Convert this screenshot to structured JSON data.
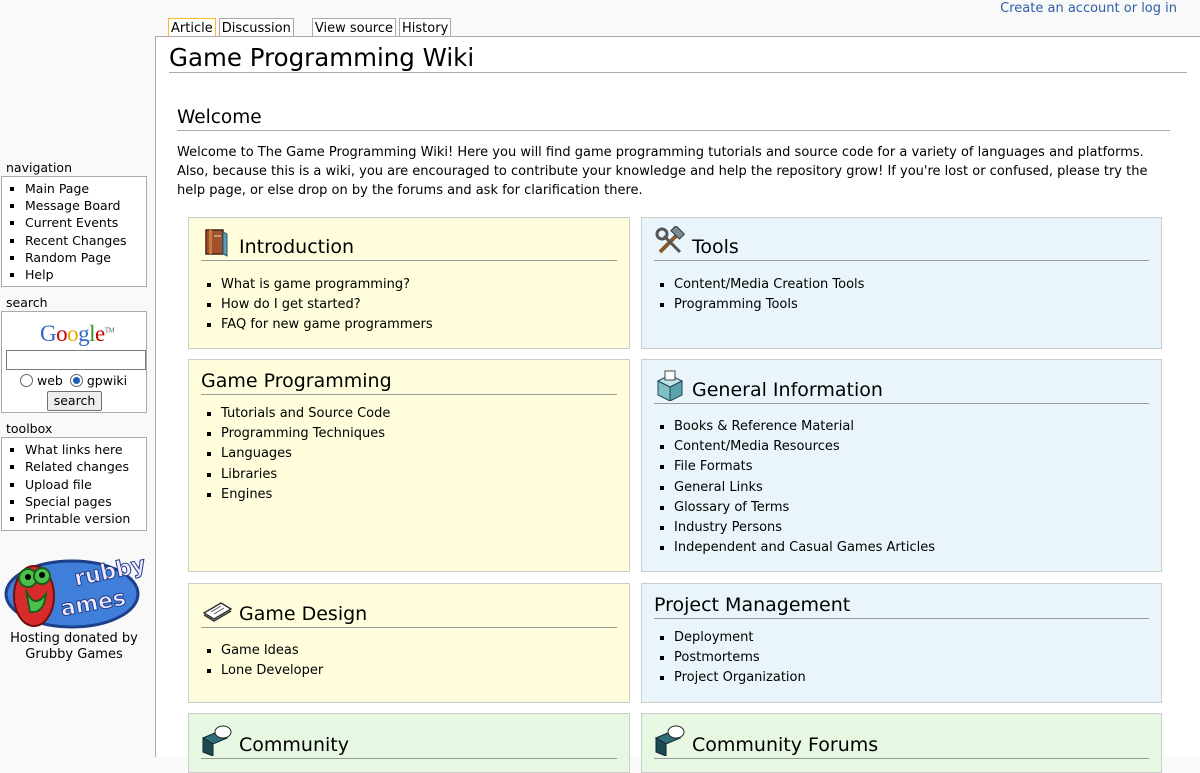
{
  "user_link": "Create an account or log in",
  "tabs": [
    "Article",
    "Discussion",
    "View source",
    "History"
  ],
  "sidebar": {
    "navigation": {
      "heading": "navigation",
      "items": [
        "Main Page",
        "Message Board",
        "Current Events",
        "Recent Changes",
        "Random Page",
        "Help"
      ]
    },
    "search": {
      "heading": "search",
      "logo_text": "Google",
      "logo_tm": "TM",
      "radio_web": "web",
      "radio_gpwiki": "gpwiki",
      "button": "search",
      "selected": "gpwiki"
    },
    "toolbox": {
      "heading": "toolbox",
      "items": [
        "What links here",
        "Related changes",
        "Upload file",
        "Special pages",
        "Printable version"
      ]
    },
    "sponsor": {
      "logo_text": "Grubby Games",
      "line1": "Hosting donated by",
      "line2": "Grubby Games"
    }
  },
  "page": {
    "title": "Game Programming Wiki",
    "welcome_heading": "Welcome",
    "intro_text": "Welcome to The Game Programming Wiki! Here you will find game programming tutorials and source code for a variety of languages and platforms. Also, because this is a wiki, you are encouraged to contribute your knowledge and help the repository grow! If you're lost or confused, please try the help page, or else drop on by the forums and ask for clarification there."
  },
  "boxes": {
    "introduction": {
      "title": "Introduction",
      "icon": "book-icon",
      "items": [
        "What is game programming?",
        "How do I get started?",
        "FAQ for new game programmers"
      ]
    },
    "tools": {
      "title": "Tools",
      "icon": "tools-icon",
      "items": [
        "Content/Media Creation Tools",
        "Programming Tools"
      ]
    },
    "game_programming": {
      "title": "Game Programming",
      "items": [
        "Tutorials and Source Code",
        "Programming Techniques",
        "Languages",
        "Libraries",
        "Engines"
      ]
    },
    "general_info": {
      "title": "General Information",
      "icon": "box-icon",
      "items": [
        "Books & Reference Material",
        "Content/Media Resources",
        "File Formats",
        "General Links",
        "Glossary of Terms",
        "Industry Persons",
        "Independent and Casual Games Articles"
      ]
    },
    "game_design": {
      "title": "Game Design",
      "icon": "paper-icon",
      "items": [
        "Game Ideas",
        "Lone Developer"
      ]
    },
    "project_management": {
      "title": "Project Management",
      "items": [
        "Deployment",
        "Postmortems",
        "Project Organization"
      ]
    },
    "community": {
      "title": "Community",
      "icon": "chat-icon"
    },
    "community_forums": {
      "title": "Community Forums",
      "icon": "chat-icon"
    }
  },
  "colors": {
    "yellow_box": "#fffddb",
    "blue_box": "#eaf5fb",
    "green_box": "#e6f7e2",
    "link": "#0645ad"
  }
}
